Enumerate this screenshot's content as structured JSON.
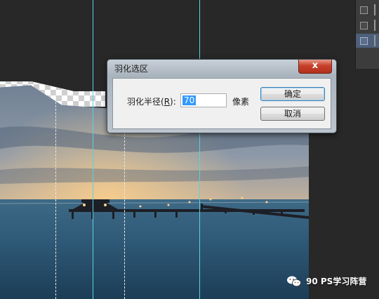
{
  "dialog": {
    "title": "羽化选区",
    "close_glyph": "x",
    "feather_label_prefix": "羽化半径(",
    "feather_label_key": "R",
    "feather_label_suffix": "):",
    "feather_value": "70",
    "unit": "像素",
    "ok_label": "确定",
    "cancel_label": "取消"
  },
  "watermark": {
    "text": "90 PS学习阵营",
    "icon": "wechat-icon"
  },
  "colors": {
    "guide": "#58d3e0",
    "close_button": "#c7412c",
    "selection_highlight": "#3399ff"
  }
}
